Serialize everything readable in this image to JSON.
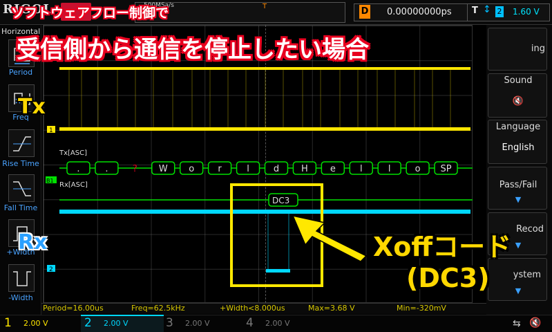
{
  "header": {
    "logo": "RIGOL",
    "sample_rate": "500MSa/s",
    "trigger_marker": "T",
    "delay_label": "D",
    "delay_value": "0.00000000ps",
    "trig_label": "T",
    "trig_edge": "↕",
    "trig_channel": "2",
    "trig_level": "1.60 V"
  },
  "left_panel": {
    "title": "Horizontal",
    "items": [
      {
        "label": "Period"
      },
      {
        "label": "Freq"
      },
      {
        "label": "Rise Time"
      },
      {
        "label": "Fall Time"
      },
      {
        "label": "+Width"
      },
      {
        "label": "-Width"
      }
    ]
  },
  "right_menu": {
    "trig_partial": "ing",
    "sound_title": "Sound",
    "sound_icon": "speaker-muted-icon",
    "language_title": "Language",
    "language_value": "English",
    "passfail_title": "Pass/Fail",
    "record_partial": "Reco",
    "record_partial2": "d",
    "system_partial": "ystem"
  },
  "waveform": {
    "ch1_marker": "1",
    "ch2_marker": "2",
    "b1_marker": "B1",
    "tx_decode_label": "Tx[ASC]",
    "rx_decode_label": "Rx[ASC]",
    "tx_symbols": [
      ".",
      ".",
      "?",
      "W",
      "o",
      "r",
      "l",
      "d",
      "H",
      "e",
      "l",
      "l",
      "o",
      "SP"
    ],
    "rx_symbol": "DC3"
  },
  "measurements": {
    "period": "Period=16.00us",
    "freq": "Freq=62.5kHz",
    "width": "+Width<8.000us",
    "max": "Max=3.68 V",
    "min": "Min=-320mV"
  },
  "channels": [
    {
      "num": "1",
      "value": "2.00 V",
      "color": "#ffe600"
    },
    {
      "num": "2",
      "value": "2.00 V",
      "color": "#00d8ff"
    },
    {
      "num": "3",
      "value": "2.00 V",
      "color": "#777777"
    },
    {
      "num": "4",
      "value": "2.00 V",
      "color": "#777777"
    }
  ],
  "overlay": {
    "line1": "ソフトウェアフロー制御で",
    "line2": "受信側から通信を停止したい場合",
    "tx_tag": "Tx",
    "rx_tag": "Rx",
    "xoff": "Xoffコード",
    "dc3": "(DC3)"
  },
  "colors": {
    "ch1": "#ffe600",
    "ch2": "#00d8ff",
    "decode": "#00e000",
    "overlay_red": "#e8001f",
    "overlay_yellow": "#ffd800"
  }
}
